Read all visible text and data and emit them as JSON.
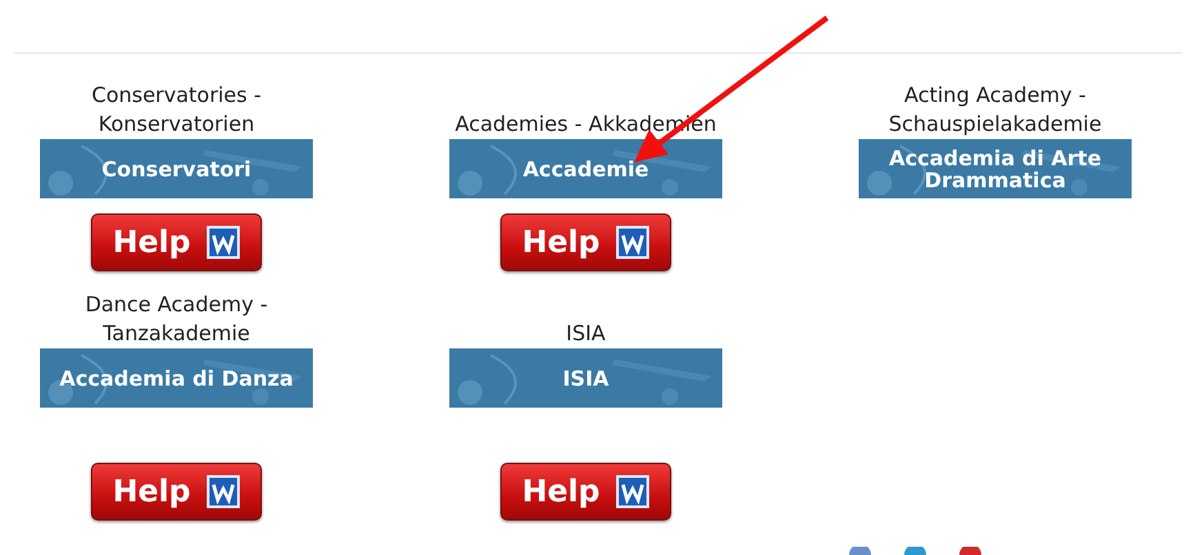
{
  "rows": [
    {
      "cells": [
        {
          "label": "Conservatories - Konservatorien",
          "banner": "Conservatori",
          "help": "Help"
        },
        {
          "label": "Academies - Akkademien",
          "banner": "Accademie",
          "help": "Help"
        },
        {
          "label": "Acting Academy - Schauspielakademie",
          "banner": "Accademia di Arte Drammatica"
        }
      ]
    },
    {
      "cells": [
        {
          "label": "Dance Academy - Tanzakademie",
          "banner": "Accademia di Danza",
          "help": "Help"
        },
        {
          "label": "ISIA",
          "banner": "ISIA",
          "help": "Help"
        }
      ]
    }
  ]
}
